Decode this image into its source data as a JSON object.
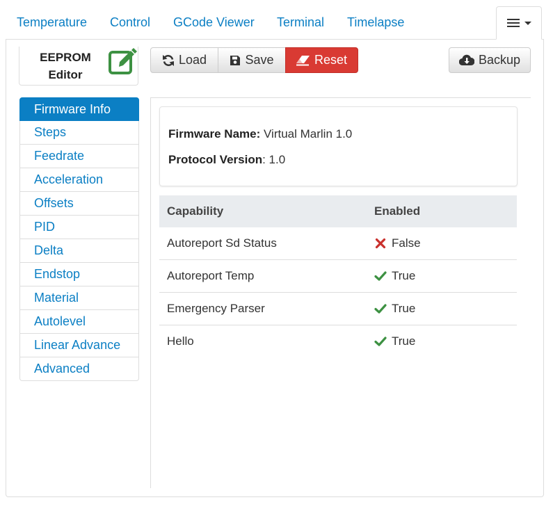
{
  "tabs": [
    {
      "label": "Temperature"
    },
    {
      "label": "Control"
    },
    {
      "label": "GCode Viewer"
    },
    {
      "label": "Terminal"
    },
    {
      "label": "Timelapse"
    }
  ],
  "editor": {
    "title_line1": "EEPROM",
    "title_line2": "Editor",
    "icon": "edit-icon"
  },
  "toolbar": {
    "load_label": "Load",
    "save_label": "Save",
    "reset_label": "Reset",
    "backup_label": "Backup"
  },
  "sidebar": {
    "items": [
      {
        "label": "Firmware Info",
        "active": true
      },
      {
        "label": "Steps"
      },
      {
        "label": "Feedrate"
      },
      {
        "label": "Acceleration"
      },
      {
        "label": "Offsets"
      },
      {
        "label": "PID"
      },
      {
        "label": "Delta"
      },
      {
        "label": "Endstop"
      },
      {
        "label": "Material"
      },
      {
        "label": "Autolevel"
      },
      {
        "label": "Linear Advance"
      },
      {
        "label": "Advanced"
      }
    ]
  },
  "firmware": {
    "name_label": "Firmware Name:",
    "name_value": "Virtual Marlin 1.0",
    "protocol_label": "Protocol Version",
    "protocol_value": ": 1.0"
  },
  "capabilities": {
    "header_capability": "Capability",
    "header_enabled": "Enabled",
    "rows": [
      {
        "name": "Autoreport Sd Status",
        "enabled": "False"
      },
      {
        "name": "Autoreport Temp",
        "enabled": "True"
      },
      {
        "name": "Emergency Parser",
        "enabled": "True"
      },
      {
        "name": "Hello",
        "enabled": "True"
      }
    ]
  },
  "colors": {
    "accent": "#0b7fc4",
    "danger": "#d93a33",
    "success": "#3d9142",
    "false_mark": "#c9302c"
  }
}
